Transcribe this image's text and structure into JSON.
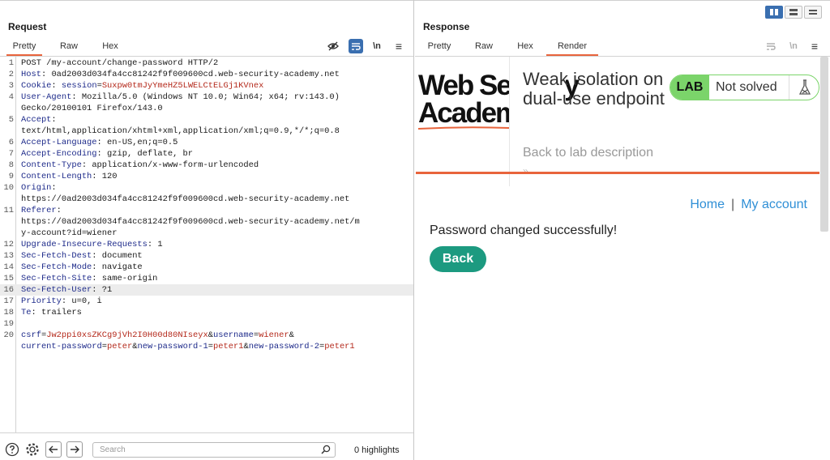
{
  "request": {
    "title": "Request",
    "tabs": [
      {
        "label": "Pretty"
      },
      {
        "label": "Raw"
      },
      {
        "label": "Hex"
      }
    ],
    "active_tab": "Pretty",
    "toolbar_icons": [
      "hide-eye-icon",
      "wrap-lines-icon",
      "newline-toggle-icon",
      "menu-icon"
    ],
    "newline_label": "\\n",
    "menu_label": "≡",
    "lines": [
      {
        "n": "1",
        "parts": [
          {
            "t": "POST /my-account/change-password HTTP/2",
            "c": "plain"
          }
        ]
      },
      {
        "n": "2",
        "parts": [
          {
            "t": "Host",
            "c": "hk"
          },
          {
            "t": ": ",
            "c": "sep"
          },
          {
            "t": "0ad2003d034fa4cc81242f9f009600cd.web-security-academy.net",
            "c": "hv"
          }
        ]
      },
      {
        "n": "3",
        "parts": [
          {
            "t": "Cookie",
            "c": "hk"
          },
          {
            "t": ": ",
            "c": "sep"
          },
          {
            "t": "session",
            "c": "ck"
          },
          {
            "t": "=",
            "c": "sep"
          },
          {
            "t": "Suxpw0tmJyYmeHZ5LWELCtELGj1KVnex",
            "c": "cv"
          }
        ]
      },
      {
        "n": "4",
        "parts": [
          {
            "t": "User-Agent",
            "c": "hk"
          },
          {
            "t": ": ",
            "c": "sep"
          },
          {
            "t": "Mozilla/5.0 (Windows NT 10.0; Win64; x64; rv:143.0)",
            "c": "hv"
          }
        ]
      },
      {
        "n": "",
        "parts": [
          {
            "t": "Gecko/20100101 Firefox/143.0",
            "c": "hv"
          }
        ]
      },
      {
        "n": "5",
        "parts": [
          {
            "t": "Accept",
            "c": "hk"
          },
          {
            "t": ":",
            "c": "sep"
          }
        ]
      },
      {
        "n": "",
        "parts": [
          {
            "t": "text/html,application/xhtml+xml,application/xml;q=0.9,*/*;q=0.8",
            "c": "hv"
          }
        ]
      },
      {
        "n": "6",
        "parts": [
          {
            "t": "Accept-Language",
            "c": "hk"
          },
          {
            "t": ": ",
            "c": "sep"
          },
          {
            "t": "en-US,en;q=0.5",
            "c": "hv"
          }
        ]
      },
      {
        "n": "7",
        "parts": [
          {
            "t": "Accept-Encoding",
            "c": "hk"
          },
          {
            "t": ": ",
            "c": "sep"
          },
          {
            "t": "gzip, deflate, br",
            "c": "hv"
          }
        ]
      },
      {
        "n": "8",
        "parts": [
          {
            "t": "Content-Type",
            "c": "hk"
          },
          {
            "t": ": ",
            "c": "sep"
          },
          {
            "t": "application/x-www-form-urlencoded",
            "c": "hv"
          }
        ]
      },
      {
        "n": "9",
        "parts": [
          {
            "t": "Content-Length",
            "c": "hk"
          },
          {
            "t": ": ",
            "c": "sep"
          },
          {
            "t": "120",
            "c": "hv"
          }
        ]
      },
      {
        "n": "10",
        "parts": [
          {
            "t": "Origin",
            "c": "hk"
          },
          {
            "t": ":",
            "c": "sep"
          }
        ]
      },
      {
        "n": "",
        "parts": [
          {
            "t": "https://0ad2003d034fa4cc81242f9f009600cd.web-security-academy.net",
            "c": "hv"
          }
        ]
      },
      {
        "n": "11",
        "parts": [
          {
            "t": "Referer",
            "c": "hk"
          },
          {
            "t": ":",
            "c": "sep"
          }
        ]
      },
      {
        "n": "",
        "parts": [
          {
            "t": "https://0ad2003d034fa4cc81242f9f009600cd.web-security-academy.net/m",
            "c": "hv"
          }
        ]
      },
      {
        "n": "",
        "parts": [
          {
            "t": "y-account?id=wiener",
            "c": "hv"
          }
        ]
      },
      {
        "n": "12",
        "parts": [
          {
            "t": "Upgrade-Insecure-Requests",
            "c": "hk"
          },
          {
            "t": ": ",
            "c": "sep"
          },
          {
            "t": "1",
            "c": "hv"
          }
        ]
      },
      {
        "n": "13",
        "parts": [
          {
            "t": "Sec-Fetch-Dest",
            "c": "hk"
          },
          {
            "t": ": ",
            "c": "sep"
          },
          {
            "t": "document",
            "c": "hv"
          }
        ]
      },
      {
        "n": "14",
        "parts": [
          {
            "t": "Sec-Fetch-Mode",
            "c": "hk"
          },
          {
            "t": ": ",
            "c": "sep"
          },
          {
            "t": "navigate",
            "c": "hv"
          }
        ]
      },
      {
        "n": "15",
        "parts": [
          {
            "t": "Sec-Fetch-Site",
            "c": "hk"
          },
          {
            "t": ": ",
            "c": "sep"
          },
          {
            "t": "same-origin",
            "c": "hv"
          }
        ]
      },
      {
        "n": "16",
        "parts": [
          {
            "t": "Sec-Fetch-User",
            "c": "hk"
          },
          {
            "t": ": ",
            "c": "sep"
          },
          {
            "t": "?1",
            "c": "hv"
          }
        ],
        "highlighted": true
      },
      {
        "n": "17",
        "parts": [
          {
            "t": "Priority",
            "c": "hk"
          },
          {
            "t": ": ",
            "c": "sep"
          },
          {
            "t": "u=0, i",
            "c": "hv"
          }
        ]
      },
      {
        "n": "18",
        "parts": [
          {
            "t": "Te",
            "c": "hk"
          },
          {
            "t": ": ",
            "c": "sep"
          },
          {
            "t": "trailers",
            "c": "hv"
          }
        ]
      },
      {
        "n": "19",
        "parts": []
      },
      {
        "n": "20",
        "parts": [
          {
            "t": "csrf",
            "c": "ck"
          },
          {
            "t": "=",
            "c": "sep"
          },
          {
            "t": "Jw2ppi0xsZKCg9jVh2I0H00d80NIseyx",
            "c": "cv"
          },
          {
            "t": "&",
            "c": "sep"
          },
          {
            "t": "username",
            "c": "ck"
          },
          {
            "t": "=",
            "c": "sep"
          },
          {
            "t": "wiener",
            "c": "cv"
          },
          {
            "t": "&",
            "c": "sep"
          }
        ]
      },
      {
        "n": "",
        "parts": [
          {
            "t": "current-password",
            "c": "ck"
          },
          {
            "t": "=",
            "c": "sep"
          },
          {
            "t": "peter",
            "c": "cv"
          },
          {
            "t": "&",
            "c": "sep"
          },
          {
            "t": "new-password-1",
            "c": "ck"
          },
          {
            "t": "=",
            "c": "sep"
          },
          {
            "t": "peter1",
            "c": "cv"
          },
          {
            "t": "&",
            "c": "sep"
          },
          {
            "t": "new-password-2",
            "c": "ck"
          },
          {
            "t": "=",
            "c": "sep"
          },
          {
            "t": "peter1",
            "c": "cv"
          }
        ]
      }
    ],
    "footer": {
      "search_placeholder": "Search",
      "highlights": "0 highlights",
      "icons": [
        "help-icon",
        "settings-icon",
        "back-arrow-icon",
        "forward-arrow-icon",
        "search-icon"
      ]
    }
  },
  "response": {
    "title": "Response",
    "tabs": [
      {
        "label": "Pretty"
      },
      {
        "label": "Raw"
      },
      {
        "label": "Hex"
      },
      {
        "label": "Render"
      }
    ],
    "active_tab": "Render",
    "layout_toggles": [
      "split-vertical-icon",
      "split-horizontal-icon",
      "single-pane-icon"
    ],
    "render": {
      "logo_line1": "Web Security",
      "logo_line2": "Academy",
      "lab_title": "Weak isolation on dual-use endpoint",
      "lab_tag": "LAB",
      "lab_status": "Not solved",
      "back_to_description": "Back to lab description",
      "chevrons": "»",
      "nav_home": "Home",
      "nav_separator": "|",
      "nav_account": "My account",
      "message": "Password changed successfully!",
      "back_button": "Back"
    }
  },
  "colors": {
    "accent": "#e8643c",
    "header_key": "#1d2a8a",
    "param_value": "#b4291b",
    "lab_green": "#7bd46a",
    "back_button": "#1c9a80",
    "link_blue": "#2f8fd6",
    "toggle_active": "#3a6fb0"
  }
}
